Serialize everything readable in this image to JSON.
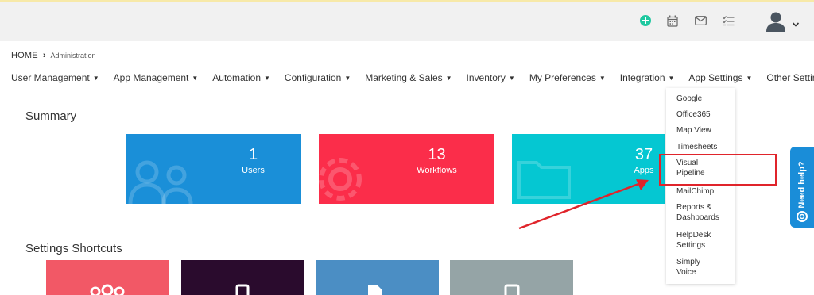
{
  "header": {
    "icons": [
      "plus-circle-icon",
      "calendar-icon",
      "mail-icon",
      "task-list-icon",
      "user-avatar-icon",
      "chevron-down-icon"
    ],
    "accent_color": "#1fc8a0"
  },
  "breadcrumb": {
    "home": "HOME",
    "separator": "›",
    "current": "Administration"
  },
  "nav": {
    "items": [
      {
        "label": "User Management"
      },
      {
        "label": "App Management"
      },
      {
        "label": "Automation"
      },
      {
        "label": "Configuration"
      },
      {
        "label": "Marketing & Sales"
      },
      {
        "label": "Inventory"
      },
      {
        "label": "My Preferences"
      },
      {
        "label": "Integration"
      },
      {
        "label": "App Settings"
      },
      {
        "label": "Other Settings"
      }
    ]
  },
  "app_settings_dropdown": {
    "options": [
      {
        "label": "Google"
      },
      {
        "label": "Office365"
      },
      {
        "label": "Map View"
      },
      {
        "label": "Timesheets"
      },
      {
        "label": "Visual Pipeline"
      },
      {
        "label": "MailChimp"
      },
      {
        "label": "Reports & Dashboards"
      },
      {
        "label": "HelpDesk Settings"
      },
      {
        "label": "Simply Voice"
      }
    ],
    "highlighted": "Visual Pipeline",
    "highlight_color": "#e0242b"
  },
  "summary": {
    "title": "Summary",
    "cards": [
      {
        "value": "1",
        "label": "Users",
        "color": "#1a8fd8",
        "icon": "users-icon"
      },
      {
        "value": "13",
        "label": "Workflows",
        "color": "#fb2d4a",
        "icon": "gear-icon"
      },
      {
        "value": "37",
        "label": "Apps",
        "color": "#05c7d2",
        "icon": "folder-icon"
      }
    ]
  },
  "settings_shortcuts": {
    "title": "Settings Shortcuts",
    "tiles": [
      {
        "color": "#f25866",
        "icon": "people-icon"
      },
      {
        "color": "#2a0b2d",
        "icon": "phone-icon"
      },
      {
        "color": "#4b8ec4",
        "icon": "document-icon"
      },
      {
        "color": "#95a4a6",
        "icon": "device-icon"
      }
    ]
  },
  "help_tab": {
    "label": "Need help?",
    "color": "#1a8dd8"
  }
}
